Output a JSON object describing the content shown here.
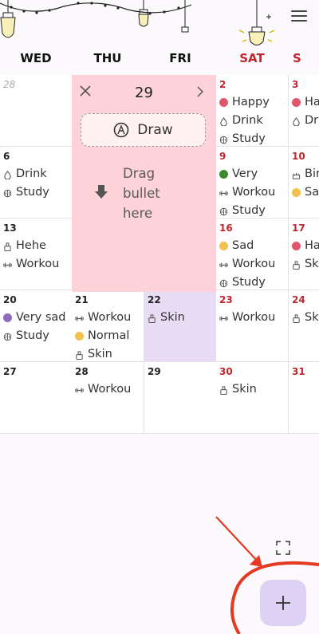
{
  "header": {
    "menu_icon": "hamburger-menu-icon",
    "decorations": [
      "hanging-lightbulb-icon",
      "string-lights"
    ]
  },
  "weekdays": [
    "WED",
    "THU",
    "FRI",
    "SAT",
    "S"
  ],
  "popup": {
    "date": "29",
    "draw_label": "Draw",
    "drag_line1": "Drag",
    "drag_line2": "bullet",
    "drag_line3": "here"
  },
  "rows": [
    {
      "cells": [
        {
          "day": "28",
          "entries": []
        },
        {
          "day": "",
          "entries": []
        },
        {
          "day": "",
          "entries": []
        },
        {
          "day": "2",
          "entries": [
            {
              "icon": "mood-happy-icon",
              "label": "Happy"
            },
            {
              "icon": "water-drop-icon",
              "label": "Drink"
            },
            {
              "icon": "brain-icon",
              "label": "Study"
            }
          ]
        },
        {
          "day": "3",
          "entries": [
            {
              "icon": "mood-happy-icon",
              "label": "Ha"
            },
            {
              "icon": "water-drop-icon",
              "label": "Dr"
            }
          ]
        }
      ]
    },
    {
      "cells": [
        {
          "day": "6",
          "entries": [
            {
              "icon": "water-drop-icon",
              "label": "Drink"
            },
            {
              "icon": "brain-icon",
              "label": "Study"
            }
          ]
        },
        {
          "day": "",
          "entries": []
        },
        {
          "day": "",
          "entries": []
        },
        {
          "day": "9",
          "entries": [
            {
              "icon": "mood-very-good-icon",
              "label": "Very"
            },
            {
              "icon": "dumbbell-icon",
              "label": "Workou"
            },
            {
              "icon": "brain-icon",
              "label": "Study"
            }
          ]
        },
        {
          "day": "10",
          "entries": [
            {
              "icon": "cake-icon",
              "label": "Bir"
            },
            {
              "icon": "mood-sad-icon",
              "label": "Sa"
            }
          ]
        }
      ]
    },
    {
      "cells": [
        {
          "day": "13",
          "entries": [
            {
              "icon": "skincare-bottle-icon",
              "label": "Hehe"
            },
            {
              "icon": "dumbbell-icon",
              "label": "Workou"
            }
          ]
        },
        {
          "day": "",
          "entries": []
        },
        {
          "day": "",
          "entries": []
        },
        {
          "day": "16",
          "entries": [
            {
              "icon": "mood-sad-icon",
              "label": "Sad"
            },
            {
              "icon": "dumbbell-icon",
              "label": "Workou"
            },
            {
              "icon": "brain-icon",
              "label": "Study"
            }
          ]
        },
        {
          "day": "17",
          "entries": [
            {
              "icon": "mood-happy-icon",
              "label": "Ha"
            },
            {
              "icon": "skincare-bottle-icon",
              "label": "Sk"
            }
          ]
        }
      ]
    },
    {
      "cells": [
        {
          "day": "20",
          "entries": [
            {
              "icon": "mood-very-sad-icon",
              "label": "Very sad"
            },
            {
              "icon": "brain-icon",
              "label": "Study"
            }
          ]
        },
        {
          "day": "21",
          "entries": [
            {
              "icon": "dumbbell-icon",
              "label": "Workou"
            },
            {
              "icon": "mood-normal-icon",
              "label": "Normal"
            },
            {
              "icon": "skincare-bottle-icon",
              "label": "Skin"
            }
          ]
        },
        {
          "day": "22",
          "entries": [
            {
              "icon": "skincare-bottle-icon",
              "label": "Skin"
            }
          ]
        },
        {
          "day": "23",
          "entries": [
            {
              "icon": "dumbbell-icon",
              "label": "Workou"
            }
          ]
        },
        {
          "day": "24",
          "entries": [
            {
              "icon": "skincare-bottle-icon",
              "label": "Sk"
            }
          ]
        }
      ]
    },
    {
      "cells": [
        {
          "day": "27",
          "entries": []
        },
        {
          "day": "28",
          "entries": [
            {
              "icon": "dumbbell-icon",
              "label": "Workou"
            }
          ]
        },
        {
          "day": "29",
          "entries": []
        },
        {
          "day": "30",
          "entries": [
            {
              "icon": "skincare-bottle-icon",
              "label": "Skin"
            }
          ]
        },
        {
          "day": "31",
          "entries": []
        }
      ]
    }
  ],
  "colors": {
    "sunday_saturday": "#c0262e",
    "popup_bg": "#fdd2d9",
    "selected_cell": "#e7dcf3",
    "fab_bg": "#ddd2f3",
    "annotation_red": "#e53a22",
    "mood_happy": "#e0576b",
    "mood_very_good": "#3c8a2e",
    "mood_sad": "#f2c14e",
    "mood_very_sad": "#8c6bbf",
    "mood_normal": "#f2c14e"
  },
  "fab": {
    "icon": "plus-icon"
  },
  "expand_icon": "expand-icon"
}
